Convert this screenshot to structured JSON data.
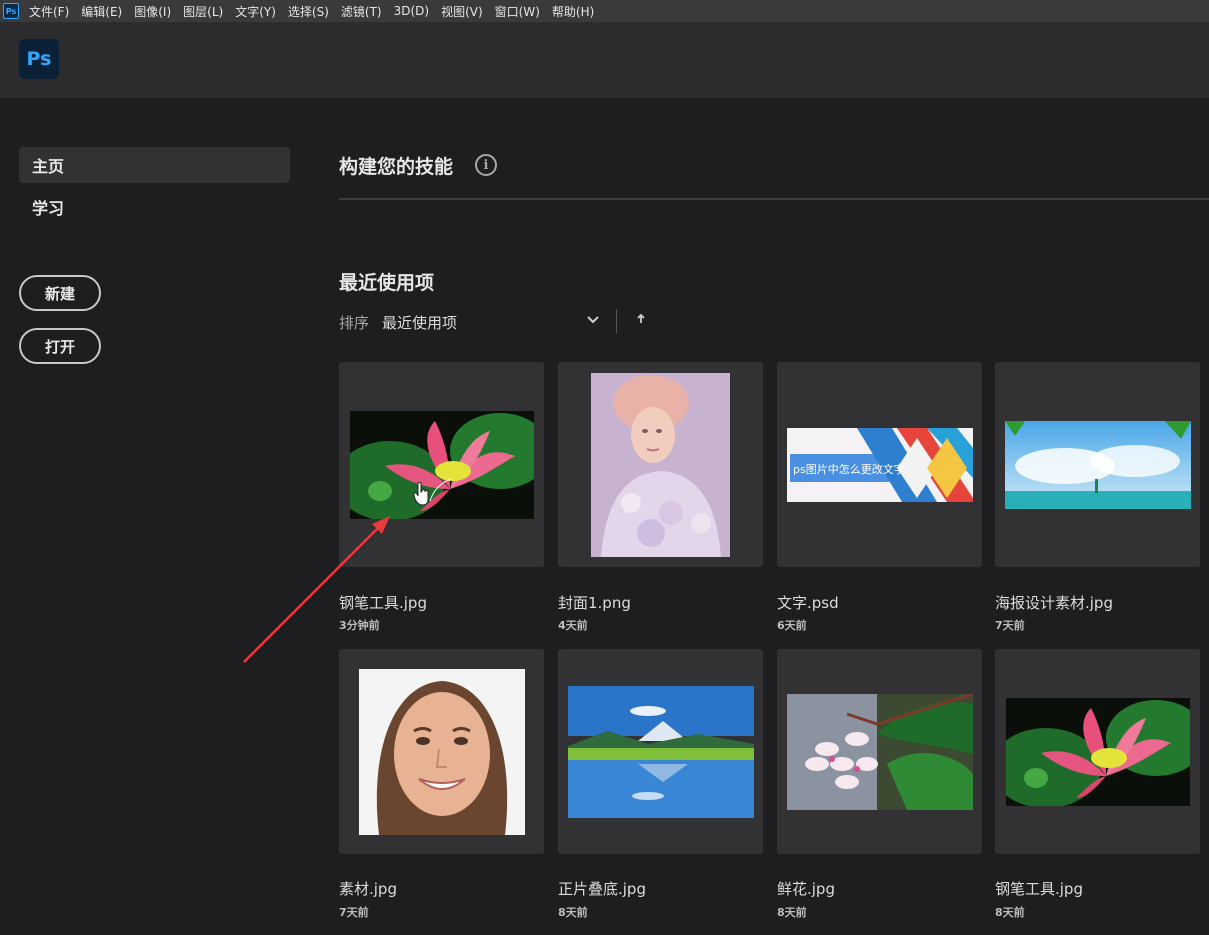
{
  "menubar": {
    "app_icon": "Ps",
    "items": [
      "文件(F)",
      "编辑(E)",
      "图像(I)",
      "图层(L)",
      "文字(Y)",
      "选择(S)",
      "滤镜(T)",
      "3D(D)",
      "视图(V)",
      "窗口(W)",
      "帮助(H)"
    ]
  },
  "header": {
    "logo": "Ps"
  },
  "sidebar": {
    "items": [
      {
        "label": "主页",
        "active": true
      },
      {
        "label": "学习",
        "active": false
      }
    ],
    "new_label": "新建",
    "open_label": "打开"
  },
  "main": {
    "skills_title": "构建您的技能",
    "info_icon": "i",
    "recent_title": "最近使用项",
    "sort_label": "排序",
    "sort_value": "最近使用项"
  },
  "files": [
    {
      "name": "钢笔工具.jpg",
      "time": "3分钟前",
      "thumb": "lotus"
    },
    {
      "name": "封面1.png",
      "time": "4天前",
      "thumb": "portrait-painting"
    },
    {
      "name": "文字.psd",
      "time": "6天前",
      "thumb": "banner",
      "thumb_text": "ps图片中怎么更改文字"
    },
    {
      "name": "海报设计素材.jpg",
      "time": "7天前",
      "thumb": "sky"
    },
    {
      "name": "素材.jpg",
      "time": "7天前",
      "thumb": "face"
    },
    {
      "name": "正片叠底.jpg",
      "time": "8天前",
      "thumb": "lake"
    },
    {
      "name": "鲜花.jpg",
      "time": "8天前",
      "thumb": "plumeria"
    },
    {
      "name": "钢笔工具.jpg",
      "time": "8天前",
      "thumb": "lotus"
    }
  ],
  "colors": {
    "accent": "#31a8ff",
    "annotation_arrow": "#e83b3b"
  }
}
